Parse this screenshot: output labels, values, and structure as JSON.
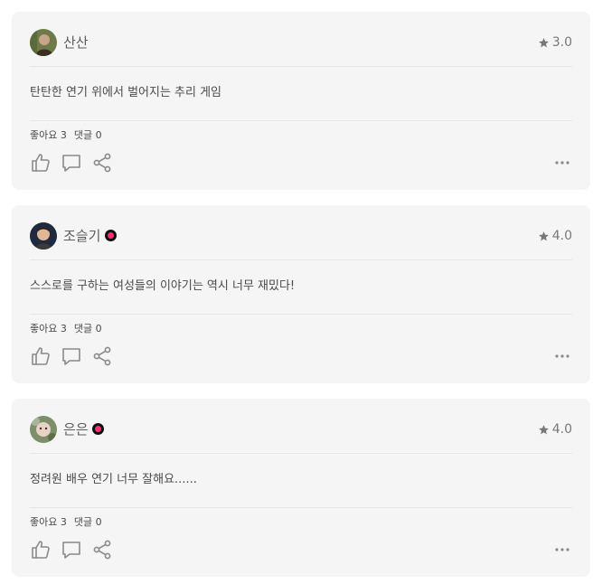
{
  "reviews": [
    {
      "user": "산산",
      "verified": false,
      "rating": "3.0",
      "comment": "탄탄한 연기 위에서 벌어지는 추리 게임",
      "likes_label": "좋아요 3",
      "replies_label": "댓글 0",
      "avatar_colors": [
        "#6f7a4a",
        "#c8a58a",
        "#3b2f22"
      ]
    },
    {
      "user": "조슬기",
      "verified": true,
      "rating": "4.0",
      "comment": "스스로를 구하는 여성들의 이야기는 역시 너무 재밌다!",
      "likes_label": "좋아요 3",
      "replies_label": "댓글 0",
      "avatar_colors": [
        "#1f2b3d",
        "#e0b796",
        "#2e1a12"
      ]
    },
    {
      "user": "은은",
      "verified": true,
      "rating": "4.0",
      "comment": "정려원 배우 연기 너무 잘해요......",
      "likes_label": "좋아요 3",
      "replies_label": "댓글 0",
      "avatar_colors": [
        "#7d8f6a",
        "#e8d2c4",
        "#a8b59a"
      ]
    }
  ],
  "colors": {
    "card_bg": "#f5f5f5",
    "badge_accent": "#ff2f6e",
    "icon": "#8a8a8a"
  },
  "icons": {
    "rating": "star-icon",
    "like": "thumbs-up-icon",
    "reply": "speech-bubble-icon",
    "share": "share-icon",
    "more": "more-dots-icon"
  }
}
